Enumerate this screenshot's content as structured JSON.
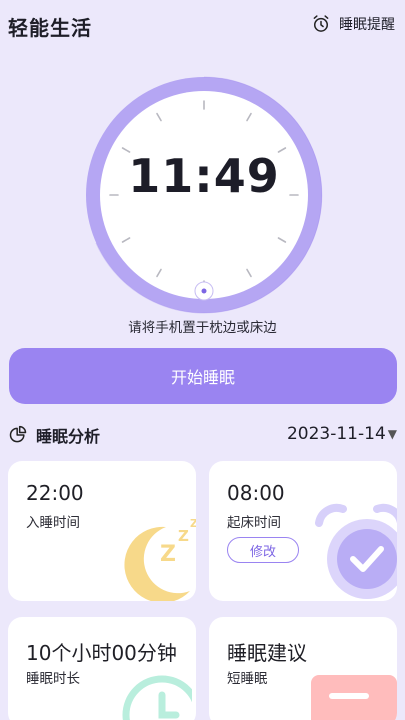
{
  "header": {
    "app_title": "轻能生活",
    "reminder_label": "睡眠提醒"
  },
  "clock": {
    "time": "11:49"
  },
  "hint": "请将手机置于枕边或床边",
  "start_button_label": "开始睡眠",
  "analysis": {
    "title": "睡眠分析",
    "date": "2023-11-14",
    "cards": [
      {
        "value": "22:00",
        "label": "入睡时间"
      },
      {
        "value": "08:00",
        "label": "起床时间",
        "action": "修改"
      },
      {
        "value": "10个小时00分钟",
        "label": "睡眠时长"
      },
      {
        "value": "睡眠建议",
        "label": "短睡眠"
      }
    ]
  },
  "colors": {
    "background": "#ece8fb",
    "accent": "#9a84f1",
    "moon": "#f7d98a"
  },
  "icons": {
    "reminder": "alarm-clock-icon",
    "analysis": "pie-chart-icon"
  }
}
